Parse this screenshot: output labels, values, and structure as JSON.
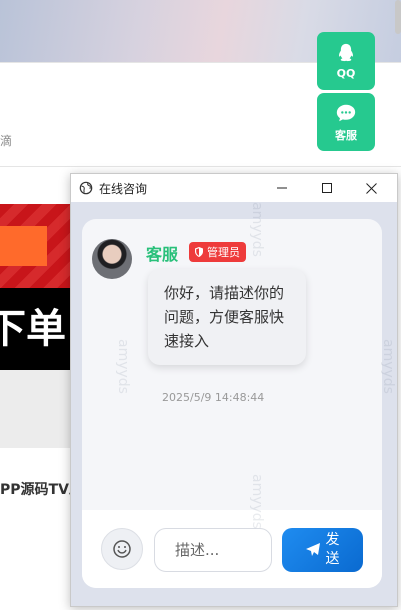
{
  "background": {
    "fragment_text": "滴",
    "black_banner_text": "下单",
    "article_title": "PP源码TV工"
  },
  "float_buttons": [
    {
      "label": "QQ",
      "icon": "qq-penguin-icon"
    },
    {
      "label": "客服",
      "icon": "chat-bubble-icon"
    }
  ],
  "window": {
    "title": "在线咨询",
    "controls": [
      "minimize-icon",
      "maximize-icon",
      "close-icon"
    ]
  },
  "chat": {
    "sender": "客服",
    "badge": "管理员",
    "message": "你好，请描述你的问题，方便客服快速接入",
    "time": "2025/5/9 14:48:44",
    "watermark": "amyyds"
  },
  "input": {
    "placeholder": "描述...",
    "send_label": "发送"
  },
  "colors": {
    "accent_green": "#26c98f",
    "sender_green": "#29c07a",
    "badge_red": "#ee3b3b",
    "send_blue": "#1f8cf0"
  }
}
